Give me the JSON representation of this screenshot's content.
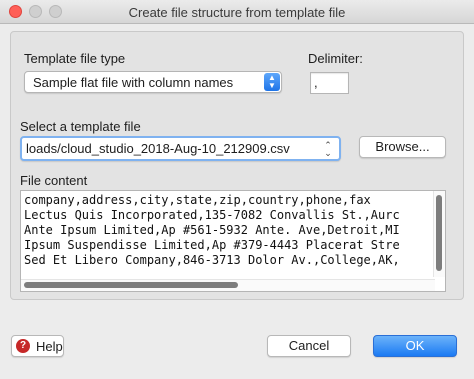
{
  "window": {
    "title": "Create file structure from template file"
  },
  "template_type": {
    "label": "Template file type",
    "selected": "Sample flat file with column names"
  },
  "delimiter": {
    "label": "Delimiter:",
    "value": ","
  },
  "template_file": {
    "label": "Select a template file",
    "selected": "loads/cloud_studio_2018-Aug-10_212909.csv",
    "browse_label": "Browse..."
  },
  "file_content": {
    "label": "File content",
    "lines": [
      "company,address,city,state,zip,country,phone,fax",
      "Lectus Quis Incorporated,135-7082 Convallis St.,Aurc",
      "Ante Ipsum Limited,Ap #561-5932 Ante. Ave,Detroit,MI",
      "Ipsum Suspendisse Limited,Ap #379-4443 Placerat Stre",
      "Sed Et Libero Company,846-3713 Dolor Av.,College,AK,"
    ]
  },
  "footer": {
    "help_label": "Help",
    "cancel_label": "Cancel",
    "ok_label": "OK"
  },
  "icons": {
    "close": "close-circle",
    "minimize": "minimize-circle",
    "maximize": "maximize-circle",
    "stepper": "up-down-chevrons",
    "help": "help-circle"
  },
  "colors": {
    "accent": "#1b7af3",
    "help_icon": "#c62828",
    "close_button": "#ff5f57"
  }
}
